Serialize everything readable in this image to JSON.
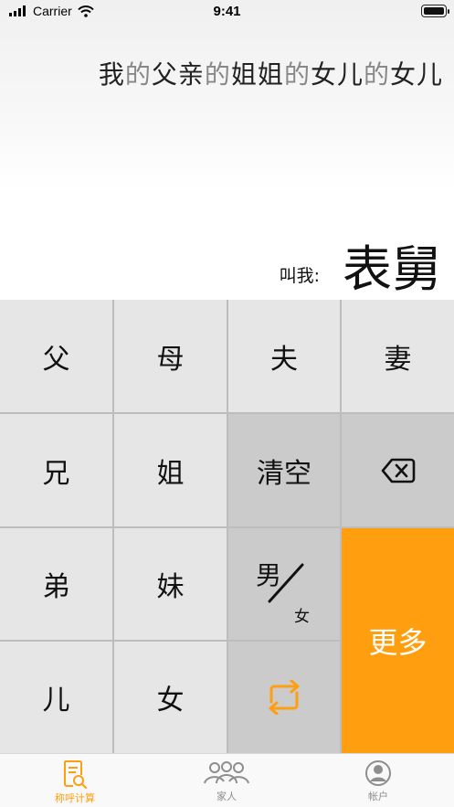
{
  "status_bar": {
    "carrier": "Carrier",
    "time": "9:41"
  },
  "display": {
    "expression": [
      {
        "text": "我",
        "kind": "word"
      },
      {
        "text": "的",
        "kind": "connector"
      },
      {
        "text": "父亲",
        "kind": "word"
      },
      {
        "text": "的",
        "kind": "connector"
      },
      {
        "text": "姐姐",
        "kind": "word"
      },
      {
        "text": "的",
        "kind": "connector"
      },
      {
        "text": "女儿",
        "kind": "word"
      },
      {
        "text": "的",
        "kind": "connector"
      },
      {
        "text": "女儿",
        "kind": "word"
      }
    ],
    "result_label": "叫我:",
    "result": "表舅"
  },
  "keypad": {
    "father": "父",
    "mother": "母",
    "husband": "夫",
    "wife": "妻",
    "elder_brother": "兄",
    "elder_sister": "姐",
    "clear": "清空",
    "younger_brother": "弟",
    "younger_sister": "妹",
    "gender_male": "男",
    "gender_female": "女",
    "son": "儿",
    "daughter": "女",
    "more": "更多",
    "backspace_icon": "backspace-icon",
    "swap_icon": "swap-icon"
  },
  "tabbar": {
    "tabs": [
      {
        "label": "称呼计算",
        "icon": "document-search-icon",
        "active": true
      },
      {
        "label": "家人",
        "icon": "people-group-icon",
        "active": false
      },
      {
        "label": "帐户",
        "icon": "user-circle-icon",
        "active": false
      }
    ]
  },
  "colors": {
    "accent": "#FF9E0F",
    "connector": "#888888",
    "key_light": "#E6E6E6",
    "key_dark": "#CBCBCB"
  }
}
